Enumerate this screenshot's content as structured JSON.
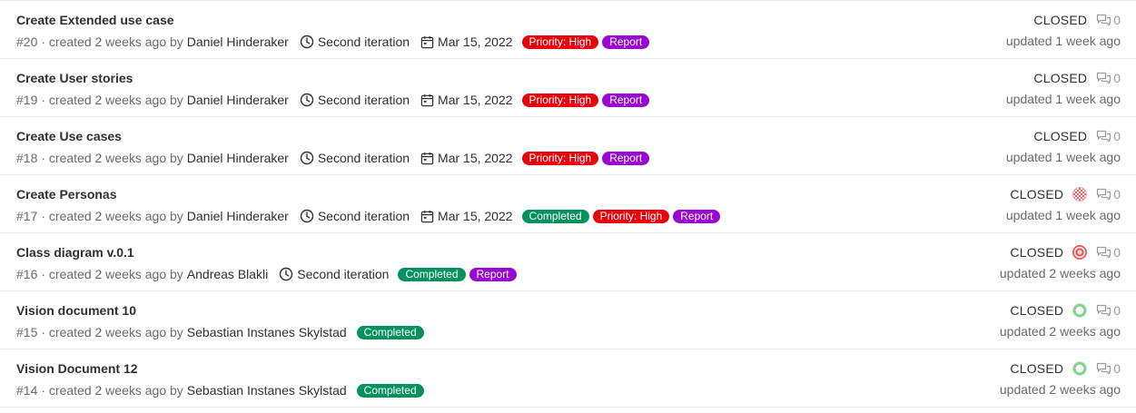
{
  "colors": {
    "priority_high": "#e9000b",
    "report": "#9a06d1",
    "completed": "#03925e"
  },
  "issues": [
    {
      "title": "Create Extended use case",
      "ref": "#20",
      "created": "· created 2 weeks ago by",
      "author": "Daniel Hinderaker",
      "milestone": "Second iteration",
      "due": "Mar 15, 2022",
      "labels": [
        {
          "text": "Priority: High",
          "color": "#e9000b"
        },
        {
          "text": "Report",
          "color": "#9a06d1"
        }
      ],
      "status": "CLOSED",
      "comments": "0",
      "updated": "updated 1 week ago",
      "avatar": "none"
    },
    {
      "title": "Create User stories",
      "ref": "#19",
      "created": "· created 2 weeks ago by",
      "author": "Daniel Hinderaker",
      "milestone": "Second iteration",
      "due": "Mar 15, 2022",
      "labels": [
        {
          "text": "Priority: High",
          "color": "#e9000b"
        },
        {
          "text": "Report",
          "color": "#9a06d1"
        }
      ],
      "status": "CLOSED",
      "comments": "0",
      "updated": "updated 1 week ago",
      "avatar": "none"
    },
    {
      "title": "Create Use cases",
      "ref": "#18",
      "created": "· created 2 weeks ago by",
      "author": "Daniel Hinderaker",
      "milestone": "Second iteration",
      "due": "Mar 15, 2022",
      "labels": [
        {
          "text": "Priority: High",
          "color": "#e9000b"
        },
        {
          "text": "Report",
          "color": "#9a06d1"
        }
      ],
      "status": "CLOSED",
      "comments": "0",
      "updated": "updated 1 week ago",
      "avatar": "none"
    },
    {
      "title": "Create Personas",
      "ref": "#17",
      "created": "· created 2 weeks ago by",
      "author": "Daniel Hinderaker",
      "milestone": "Second iteration",
      "due": "Mar 15, 2022",
      "labels": [
        {
          "text": "Completed",
          "color": "#03925e"
        },
        {
          "text": "Priority: High",
          "color": "#e9000b"
        },
        {
          "text": "Report",
          "color": "#9a06d1"
        }
      ],
      "status": "CLOSED",
      "comments": "0",
      "updated": "updated 1 week ago",
      "avatar": "checker-red"
    },
    {
      "title": "Class diagram v.0.1",
      "ref": "#16",
      "created": "· created 2 weeks ago by",
      "author": "Andreas Blakli",
      "milestone": "Second iteration",
      "due": "",
      "labels": [
        {
          "text": "Completed",
          "color": "#03925e"
        },
        {
          "text": "Report",
          "color": "#9a06d1"
        }
      ],
      "status": "CLOSED",
      "comments": "0",
      "updated": "updated 2 weeks ago",
      "avatar": "ring-red"
    },
    {
      "title": "Vision document 10",
      "ref": "#15",
      "created": "· created 2 weeks ago by",
      "author": "Sebastian Instanes Skylstad",
      "milestone": "",
      "due": "",
      "labels": [
        {
          "text": "Completed",
          "color": "#03925e"
        }
      ],
      "status": "CLOSED",
      "comments": "0",
      "updated": "updated 2 weeks ago",
      "avatar": "ring-green"
    },
    {
      "title": "Vision Document 12",
      "ref": "#14",
      "created": "· created 2 weeks ago by",
      "author": "Sebastian Instanes Skylstad",
      "milestone": "",
      "due": "",
      "labels": [
        {
          "text": "Completed",
          "color": "#03925e"
        }
      ],
      "status": "CLOSED",
      "comments": "0",
      "updated": "updated 2 weeks ago",
      "avatar": "ring-green"
    }
  ]
}
